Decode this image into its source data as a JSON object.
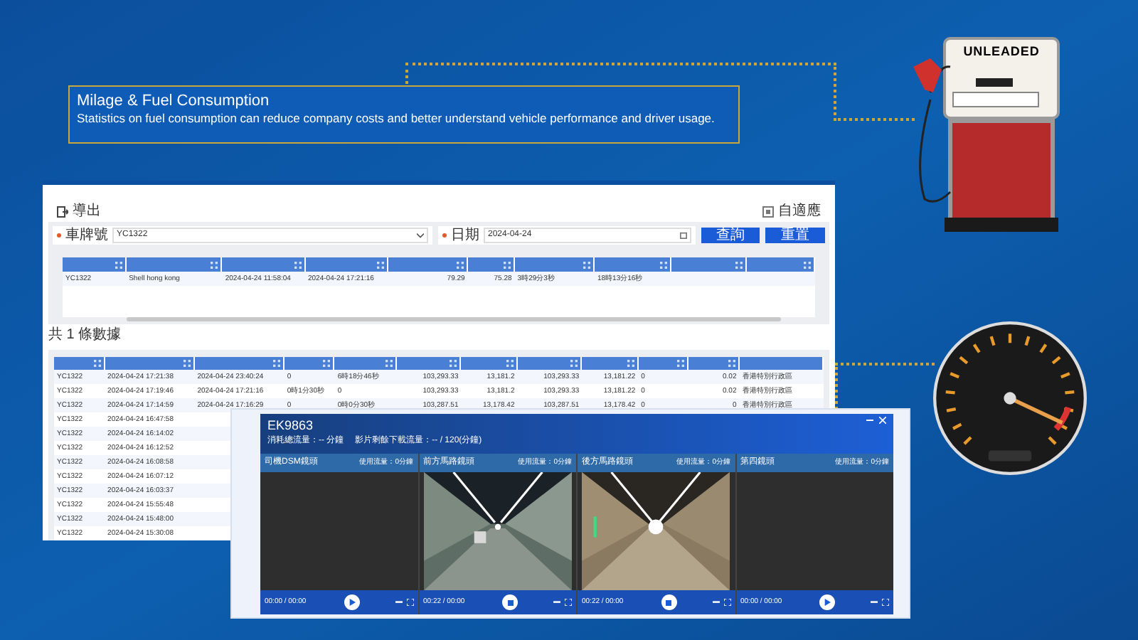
{
  "caption": {
    "title": "Milage & Fuel Consumption",
    "text": "Statistics on fuel consumption can reduce company costs and better understand vehicle performance and driver usage."
  },
  "pump": {
    "label": "UNLEADED"
  },
  "report": {
    "export": "導出",
    "adapt": "自適應",
    "filters": [
      {
        "label": "車牌號",
        "value": "YC1322",
        "kind": "select"
      },
      {
        "label": "日期",
        "value": "2024-04-24",
        "kind": "date"
      }
    ],
    "buttons": [
      "查詢",
      "重置"
    ],
    "summary_rows": [
      [
        "YC1322",
        "Shell hong kong",
        "2024-04-24 11:58:04",
        "2024-04-24 17:21:16",
        "79.29",
        "75.28",
        "3時29分3秒",
        "18時13分16秒",
        "",
        ""
      ]
    ],
    "count": "共 1 條數據",
    "rows": [
      [
        "YC1322",
        "2024-04-24 17:21:38",
        "2024-04-24 23:40:24",
        "0",
        "6時18分46秒",
        "103,293.33",
        "13,181.2",
        "103,293.33",
        "13,181.22",
        "0",
        "0.02",
        "香港特別行政區"
      ],
      [
        "YC1322",
        "2024-04-24 17:19:46",
        "2024-04-24 17:21:16",
        "0時1分30秒",
        "0",
        "103,293.33",
        "13,181.2",
        "103,293.33",
        "13,181.22",
        "0",
        "0.02",
        "香港特別行政區"
      ],
      [
        "YC1322",
        "2024-04-24 17:14:59",
        "2024-04-24 17:16:29",
        "0",
        "0時0分30秒",
        "103,287.51",
        "13,178.42",
        "103,287.51",
        "13,178.42",
        "0",
        "0",
        "香港特別行政區"
      ],
      [
        "YC1322",
        "2024-04-24 16:47:58"
      ],
      [
        "YC1322",
        "2024-04-24 16:14:02"
      ],
      [
        "YC1322",
        "2024-04-24 16:12:52"
      ],
      [
        "YC1322",
        "2024-04-24 16:08:58"
      ],
      [
        "YC1322",
        "2024-04-24 16:07:12"
      ],
      [
        "YC1322",
        "2024-04-24 16:03:37"
      ],
      [
        "YC1322",
        "2024-04-24 15:55:48"
      ],
      [
        "YC1322",
        "2024-04-24 15:48:00"
      ],
      [
        "YC1322",
        "2024-04-24 15:30:08"
      ]
    ]
  },
  "player": {
    "title": "EK9863",
    "usage": "消耗總流量：-- 分鐘",
    "remaining": "影片剩餘下載流量：-- / 120(分鐘)",
    "cameras": [
      {
        "name": "司機DSM鏡頭",
        "usage": "使用流量：0分鐘",
        "kind": "empty",
        "time": "00:00 / 00:00",
        "playing": false
      },
      {
        "name": "前方馬路鏡頭",
        "usage": "使用流量：0分鐘",
        "kind": "video",
        "time": "00:22 / 00:00",
        "playing": true
      },
      {
        "name": "後方馬路鏡頭",
        "usage": "使用流量：0分鐘",
        "kind": "video",
        "time": "00:22 / 00:00",
        "playing": true
      },
      {
        "name": "第四鏡頭",
        "usage": "使用流量：0分鐘",
        "kind": "empty",
        "time": "00:00 / 00:00",
        "playing": false
      }
    ]
  }
}
